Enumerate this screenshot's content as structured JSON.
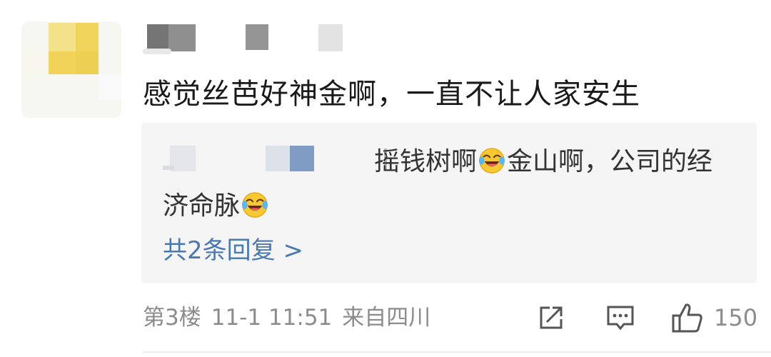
{
  "comment": {
    "text": "感觉丝芭好神金啊，一直不让人家安生"
  },
  "reply": {
    "text_part1": "摇钱树啊",
    "text_part2": "金山啊，公司的经济命脉",
    "emoji_name": "laughing-crying-emoji",
    "reply_count_label": "共2条回复 >"
  },
  "meta": {
    "floor": "第3楼",
    "datetime": "11-1 11:51",
    "location": "来自四川"
  },
  "actions": {
    "share_icon": "share-icon",
    "comment_icon": "comment-icon",
    "like_icon": "thumbs-up-icon",
    "like_count": "150"
  },
  "colors": {
    "link": "#4a78b0",
    "meta": "#8c8c8c",
    "reply_bg": "#f5f5f5",
    "avatar_yellow": "#f2d35a"
  }
}
